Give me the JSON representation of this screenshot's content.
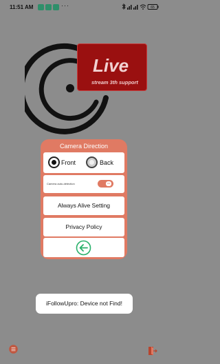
{
  "status_bar": {
    "time": "11:51 AM",
    "more_indicator": "···",
    "battery_level": "65"
  },
  "logo": {
    "live_text": "Live",
    "subtitle": "stream 3th support"
  },
  "panel": {
    "title": "Camera Direction",
    "front_label": "Front",
    "back_label": "Back",
    "selected": "front",
    "auto_detection_label": "Camera auto-detection",
    "auto_detection_state": "ON",
    "always_alive_label": "Always Alive Setting",
    "privacy_label": "Privacy Policy"
  },
  "toast": {
    "message": "iFollowUpro: Device not Find!"
  },
  "colors": {
    "accent": "#e07a63",
    "live_red": "#9a1010",
    "background": "#8c8c8c",
    "back_arrow": "#28b06a"
  },
  "icons": {
    "menu": "menu-icon",
    "exit": "exit-icon",
    "back": "back-arrow-icon"
  }
}
